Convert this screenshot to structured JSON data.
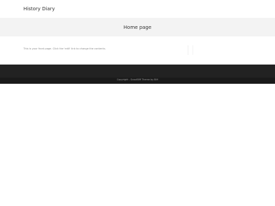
{
  "header": {
    "site_title": "History Diary"
  },
  "banner": {
    "page_title": "Home page"
  },
  "content": {
    "text": "This is your front page. Click the 'edit' link to change the contents."
  },
  "footer": {
    "copyright": "Copyright - ScoutBiff Theme by BiH"
  }
}
